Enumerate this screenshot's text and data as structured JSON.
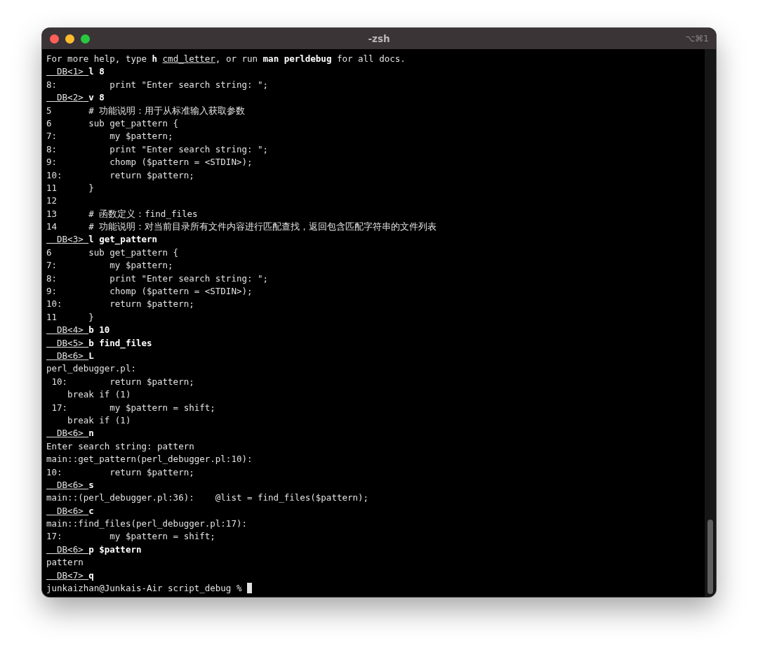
{
  "window": {
    "title": "-zsh",
    "shortcut": "⌥⌘1"
  },
  "lines": [
    {
      "kind": "help",
      "lead": "For more help, type **h** ",
      "term": "cmd_letter",
      "tail": ", or run **man perldebug** for all docs."
    },
    {
      "kind": "prompt",
      "prompt": "  DB<1> ",
      "command": "l 8"
    },
    {
      "kind": "output",
      "text": "8:          print \"Enter search string: \";"
    },
    {
      "kind": "prompt",
      "prompt": "  DB<2> ",
      "command": "v 8"
    },
    {
      "kind": "output",
      "text": "5       # 功能说明：用于从标准输入获取参数"
    },
    {
      "kind": "output",
      "text": "6       sub get_pattern {"
    },
    {
      "kind": "output",
      "text": "7:          my $pattern;"
    },
    {
      "kind": "output",
      "text": "8:          print \"Enter search string: \";"
    },
    {
      "kind": "output",
      "text": "9:          chomp ($pattern = <STDIN>);"
    },
    {
      "kind": "output",
      "text": "10:         return $pattern;"
    },
    {
      "kind": "output",
      "text": "11      }"
    },
    {
      "kind": "output",
      "text": "12"
    },
    {
      "kind": "output",
      "text": "13      # 函数定义：find_files"
    },
    {
      "kind": "output",
      "text": "14      # 功能说明：对当前目录所有文件内容进行匹配查找，返回包含匹配字符串的文件列表"
    },
    {
      "kind": "prompt",
      "prompt": "  DB<3> ",
      "command": "l get_pattern"
    },
    {
      "kind": "output",
      "text": "6       sub get_pattern {"
    },
    {
      "kind": "output",
      "text": "7:          my $pattern;"
    },
    {
      "kind": "output",
      "text": "8:          print \"Enter search string: \";"
    },
    {
      "kind": "output",
      "text": "9:          chomp ($pattern = <STDIN>);"
    },
    {
      "kind": "output",
      "text": "10:         return $pattern;"
    },
    {
      "kind": "output",
      "text": "11      }"
    },
    {
      "kind": "prompt",
      "prompt": "  DB<4> ",
      "command": "b 10"
    },
    {
      "kind": "prompt",
      "prompt": "  DB<5> ",
      "command": "b find_files"
    },
    {
      "kind": "prompt",
      "prompt": "  DB<6> ",
      "command": "L"
    },
    {
      "kind": "output",
      "text": "perl_debugger.pl:"
    },
    {
      "kind": "output",
      "text": " 10:        return $pattern;"
    },
    {
      "kind": "output",
      "text": "    break if (1)"
    },
    {
      "kind": "output",
      "text": " 17:        my $pattern = shift;"
    },
    {
      "kind": "output",
      "text": "    break if (1)"
    },
    {
      "kind": "prompt",
      "prompt": "  DB<6> ",
      "command": "n"
    },
    {
      "kind": "output",
      "text": "Enter search string: pattern"
    },
    {
      "kind": "output",
      "text": "main::get_pattern(perl_debugger.pl:10):"
    },
    {
      "kind": "output",
      "text": "10:         return $pattern;"
    },
    {
      "kind": "prompt",
      "prompt": "  DB<6> ",
      "command": "s"
    },
    {
      "kind": "output",
      "text": "main::(perl_debugger.pl:36):    @list = find_files($pattern);"
    },
    {
      "kind": "prompt",
      "prompt": "  DB<6> ",
      "command": "c"
    },
    {
      "kind": "output",
      "text": "main::find_files(perl_debugger.pl:17):"
    },
    {
      "kind": "output",
      "text": "17:         my $pattern = shift;"
    },
    {
      "kind": "prompt",
      "prompt": "  DB<6> ",
      "command": "p $pattern"
    },
    {
      "kind": "output",
      "text": "pattern"
    },
    {
      "kind": "prompt",
      "prompt": "  DB<7> ",
      "command": "q"
    },
    {
      "kind": "shell",
      "text": "junkaizhan@Junkais-Air script_debug % "
    }
  ]
}
